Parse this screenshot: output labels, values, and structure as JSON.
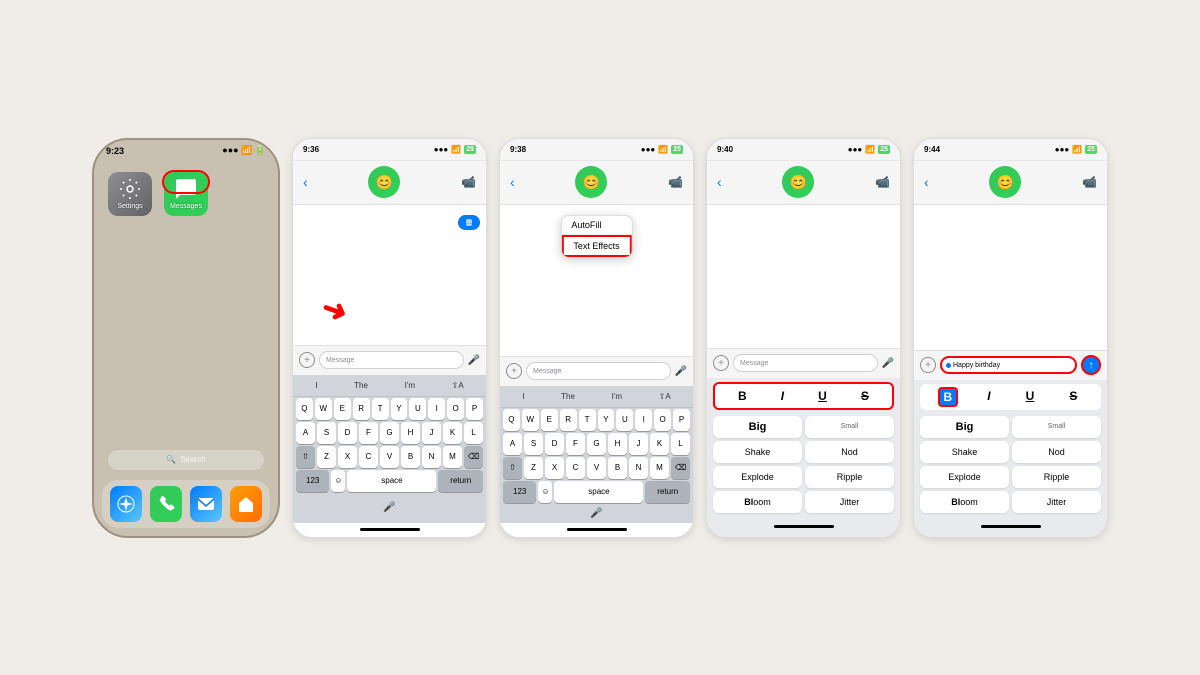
{
  "background": "#f0ede8",
  "screen1": {
    "time": "9:23",
    "apps": [
      {
        "name": "Settings",
        "type": "settings"
      },
      {
        "name": "Messages",
        "type": "messages",
        "highlighted": true
      }
    ],
    "search": "Search",
    "dock": [
      "Safari",
      "Phone",
      "Mail",
      "Home"
    ]
  },
  "screen2": {
    "time": "9:36",
    "inputPlaceholder": "Message",
    "suggestions": [
      "I",
      "The",
      "I'm",
      "↵A"
    ]
  },
  "screen3": {
    "time": "9:38",
    "inputPlaceholder": "Message",
    "tooltip": {
      "items": [
        "AutoFill",
        "Text Effects"
      ]
    }
  },
  "screen4": {
    "time": "9:40",
    "inputPlaceholder": "Message",
    "formatting": [
      "B",
      "I",
      "U",
      "S"
    ],
    "effects": [
      "Big",
      "Small",
      "Shake",
      "Nod",
      "Explode",
      "Ripple",
      "Bloom",
      "Jitter"
    ]
  },
  "screen5": {
    "time": "9:44",
    "inputText": "Happy birthday",
    "formatting": [
      "B",
      "I",
      "U",
      "S"
    ],
    "effects": [
      "Big",
      "Small",
      "Shake",
      "Nod",
      "Explode",
      "Ripple",
      "Bloom",
      "Jitter"
    ]
  },
  "keys": {
    "row1": [
      "Q",
      "W",
      "E",
      "R",
      "T",
      "Y",
      "U",
      "I",
      "O",
      "P"
    ],
    "row2": [
      "A",
      "S",
      "D",
      "F",
      "G",
      "H",
      "J",
      "K",
      "L"
    ],
    "row3": [
      "Z",
      "X",
      "C",
      "V",
      "B",
      "N",
      "M"
    ],
    "bottom": [
      "123",
      "space",
      "return"
    ]
  }
}
